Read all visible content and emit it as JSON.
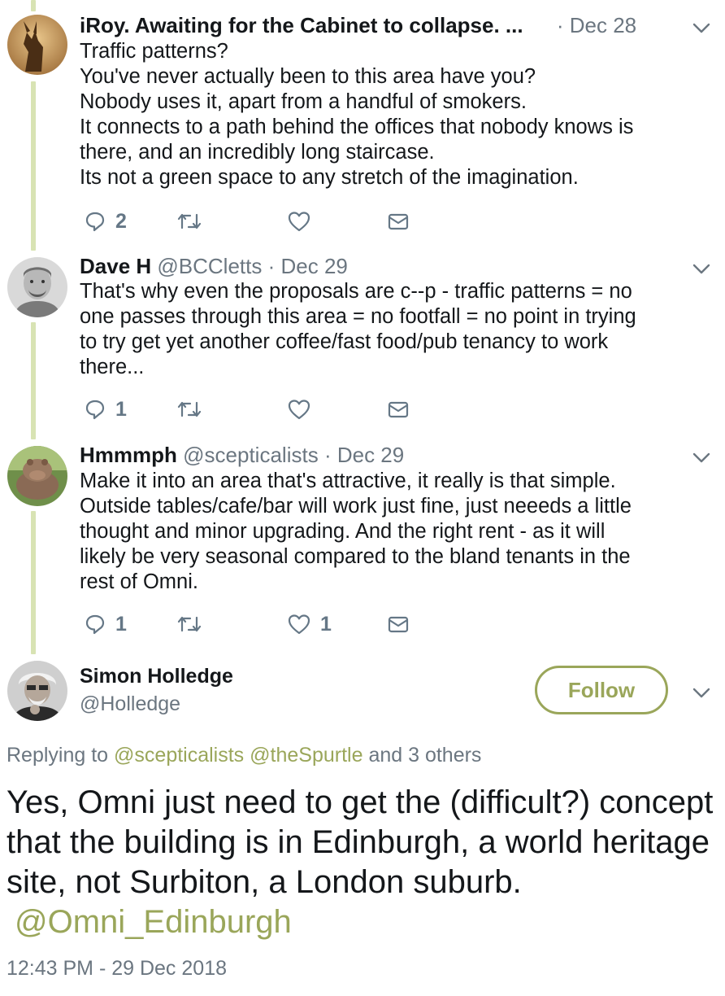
{
  "tweets": [
    {
      "name": "iRoy. Awaiting for the Cabinet to collapse. ...",
      "handle": "",
      "sep": "·",
      "date": "Dec 28",
      "lines": [
        "Traffic patterns?",
        "You've never actually been to this area have you?",
        "Nobody uses it, apart from a handful of smokers.",
        "It connects to a path behind the offices that nobody knows is",
        "there, and an incredibly long staircase.",
        "Its not a green space to any stretch of the imagination."
      ],
      "reply_count": "2",
      "retweet_count": "",
      "like_count": ""
    },
    {
      "name": "Dave H",
      "handle": "@BCCletts",
      "sep": "·",
      "date": "Dec 29",
      "lines": [
        "That's why even the proposals are c--p - traffic patterns = no",
        "one passes through this area = no footfall = no point in trying",
        "to try get yet another coffee/fast food/pub tenancy to work",
        "there..."
      ],
      "reply_count": "1",
      "retweet_count": "",
      "like_count": ""
    },
    {
      "name": "Hmmmph",
      "handle": "@scepticalists",
      "sep": "·",
      "date": "Dec 29",
      "lines": [
        "Make it into an area that's attractive, it really is that simple.",
        "Outside tables/cafe/bar will work just fine, just neeeds a little",
        "thought and minor upgrading. And the right rent - as it will",
        "likely be very seasonal compared to the bland tenants in the",
        "rest of Omni."
      ],
      "reply_count": "1",
      "retweet_count": "",
      "like_count": "1"
    }
  ],
  "main_tweet": {
    "name": "Simon Holledge",
    "handle": "@Holledge",
    "follow_label": "Follow",
    "replying_prefix": "Replying to",
    "replying_mentions": [
      "@scepticalists",
      "@theSpurtle"
    ],
    "replying_suffix": "and 3 others",
    "text": "Yes, Omni just need to get the (difficult?) concept that the building is in Edinburgh, a world heritage site, not Surbiton, a London suburb.",
    "text_mention": "@Omni_Edinburgh",
    "timestamp": "12:43 PM - 29 Dec 2018"
  },
  "icons": {
    "reply": "reply-icon",
    "retweet": "retweet-icon",
    "like": "heart-icon",
    "dm": "envelope-icon",
    "caret": "chevron-down-icon"
  },
  "colors": {
    "accent": "#9aa65a",
    "thread_line": "#d8e3b3",
    "secondary_text": "#6b7680"
  }
}
